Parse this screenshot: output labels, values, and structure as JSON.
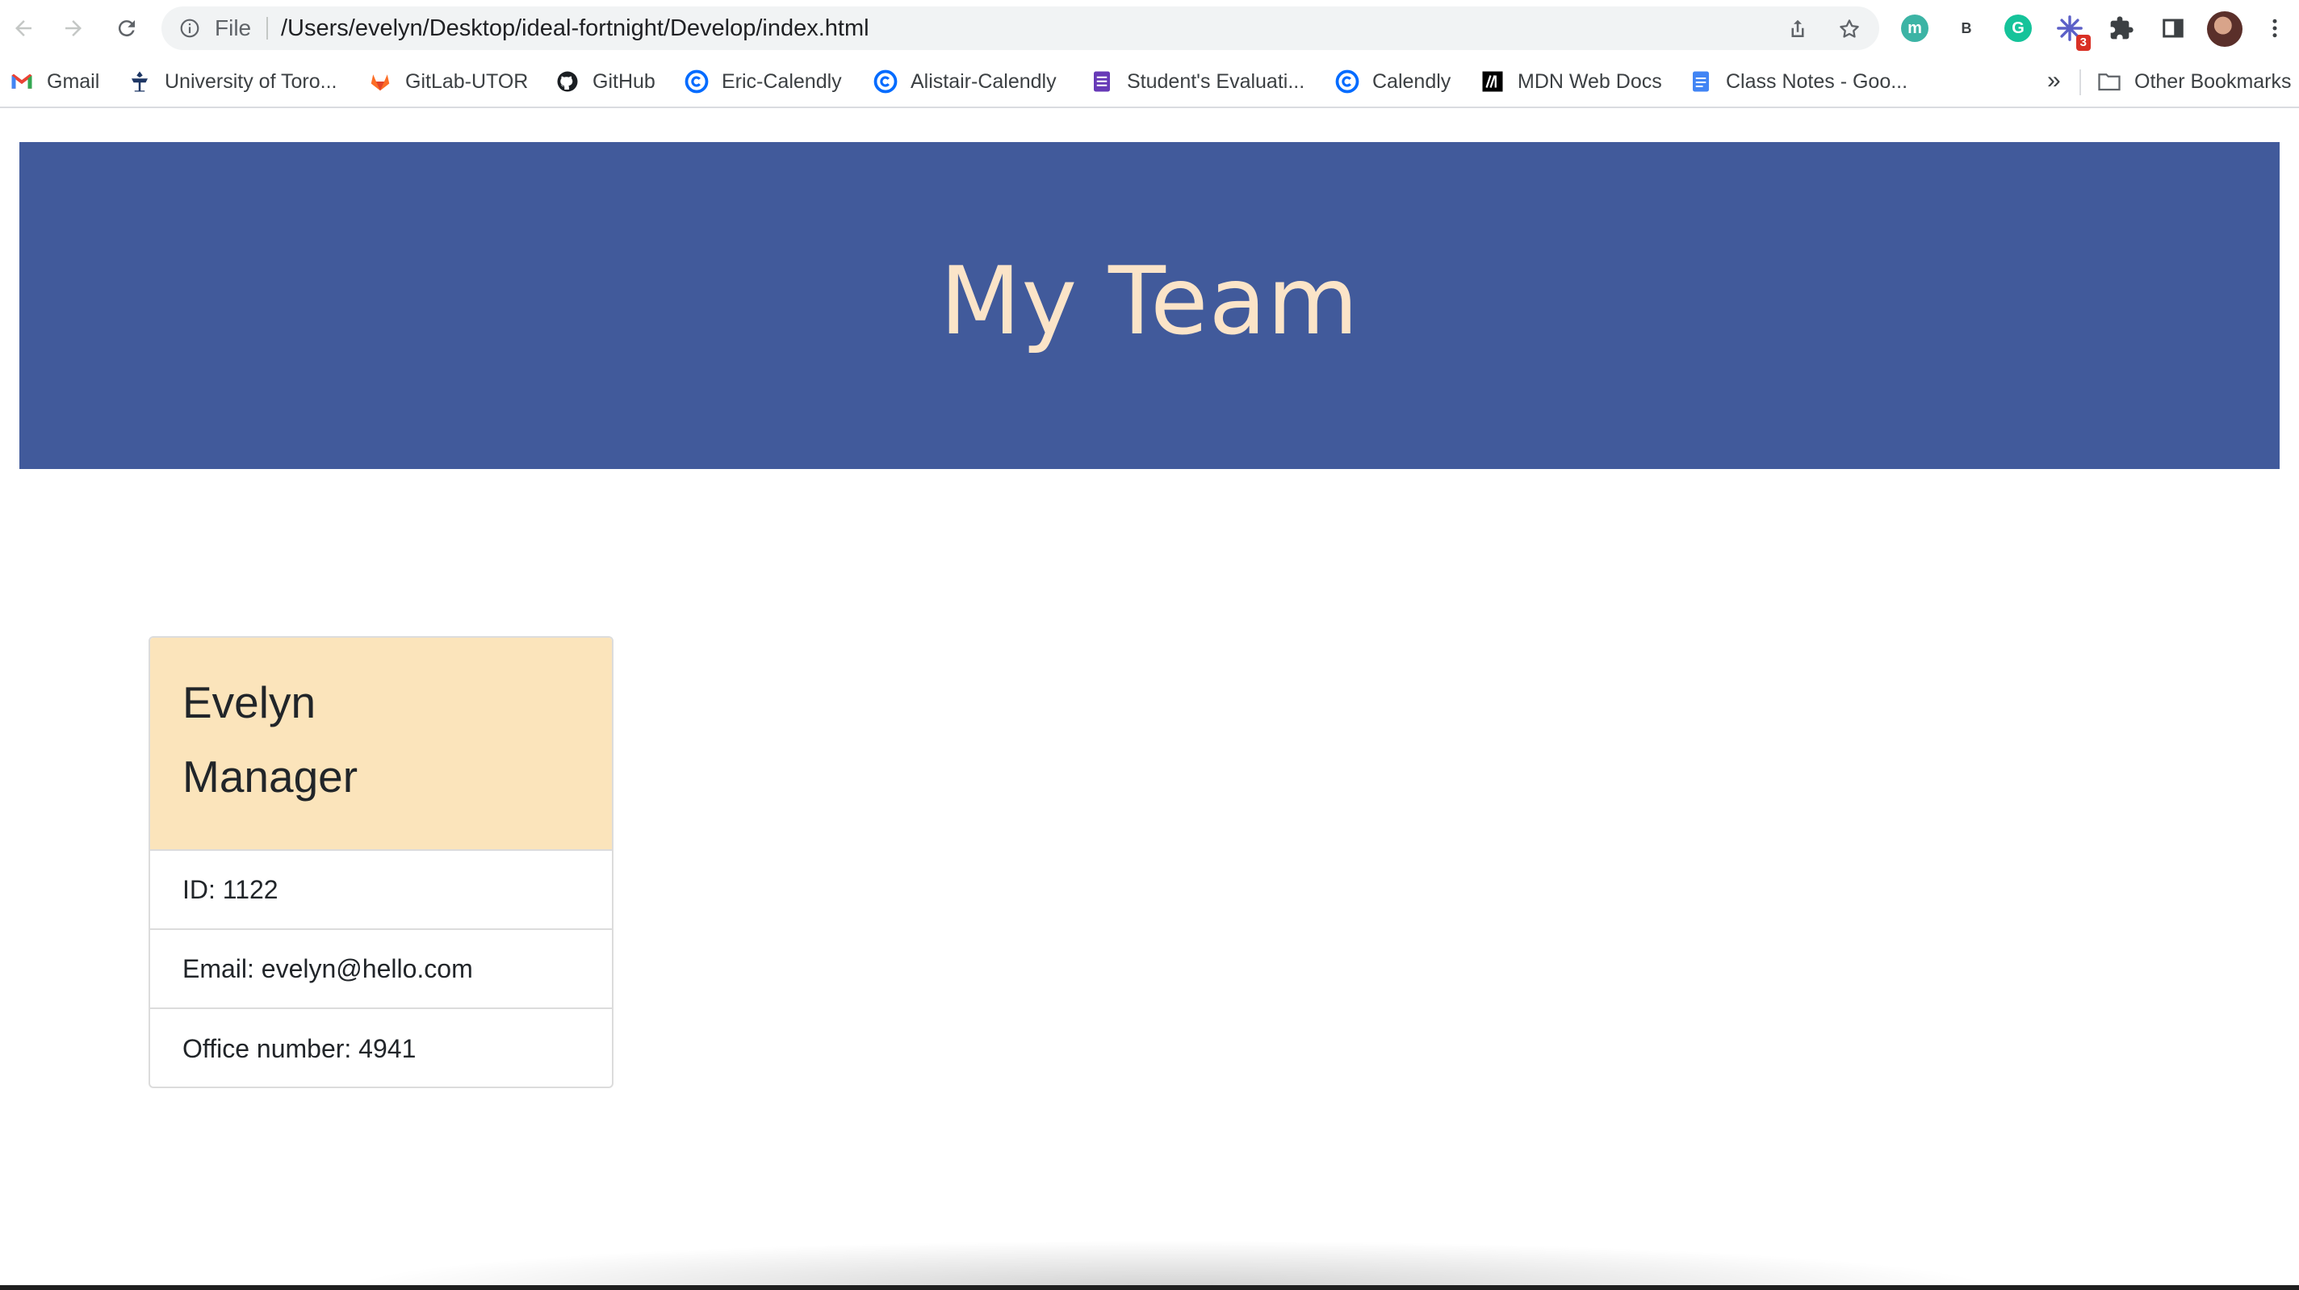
{
  "browser": {
    "omnibox": {
      "scheme_label": "File",
      "url": "/Users/evelyn/Desktop/ideal-fortnight/Develop/index.html"
    },
    "extensions": [
      {
        "letter": "m",
        "color": "#3cb4a5"
      },
      {
        "letter": "B",
        "color": "#ffffff"
      },
      {
        "letter": "G",
        "color": "#15c39a"
      },
      {
        "badge": "3",
        "color": "#5b5fc7"
      }
    ],
    "bookmarks": [
      {
        "label": "Gmail",
        "icon": "gmail-icon"
      },
      {
        "label": "University of Toro...",
        "icon": "university-crest-icon"
      },
      {
        "label": "GitLab-UTOR",
        "icon": "gitlab-icon"
      },
      {
        "label": "GitHub",
        "icon": "github-icon"
      },
      {
        "label": "Eric-Calendly",
        "icon": "calendly-icon"
      },
      {
        "label": "Alistair-Calendly",
        "icon": "calendly-icon"
      },
      {
        "label": "Student's Evaluati...",
        "icon": "forms-icon"
      },
      {
        "label": "Calendly",
        "icon": "calendly-icon"
      },
      {
        "label": "MDN Web Docs",
        "icon": "mdn-icon"
      },
      {
        "label": "Class Notes - Goo...",
        "icon": "docs-icon"
      }
    ],
    "overflow_label": "»",
    "other_bookmarks_label": "Other Bookmarks"
  },
  "page": {
    "title": "My Team",
    "colors": {
      "jumbotron_bg": "#415a9b",
      "title_color": "#fbe4c8",
      "card_header_bg": "#fbe4bb"
    },
    "card": {
      "name": "Evelyn",
      "role": "Manager",
      "id_text": "ID: 1122",
      "email_text": "Email: evelyn@hello.com",
      "office_text": "Office number: 4941"
    }
  }
}
